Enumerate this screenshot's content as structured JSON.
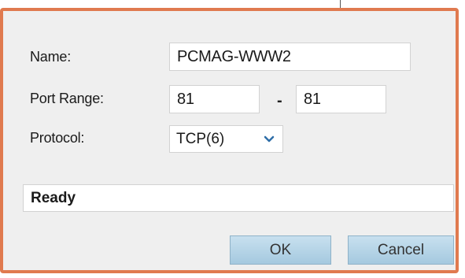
{
  "form": {
    "name_label": "Name:",
    "name_value": "PCMAG-WWW2",
    "port_label": "Port Range:",
    "port_start": "81",
    "port_separator": "-",
    "port_end": "81",
    "protocol_label": "Protocol:",
    "protocol_value": "TCP(6)",
    "status": "Ready"
  },
  "buttons": {
    "ok": "OK",
    "cancel": "Cancel"
  },
  "icons": {
    "protocol_dropdown": "chevron-down-icon"
  },
  "colors": {
    "frame_border": "#e07a4f",
    "dialog_background": "#efefef",
    "button_fill": "#b8d6ea",
    "dropdown_chevron": "#2f6ea8"
  }
}
